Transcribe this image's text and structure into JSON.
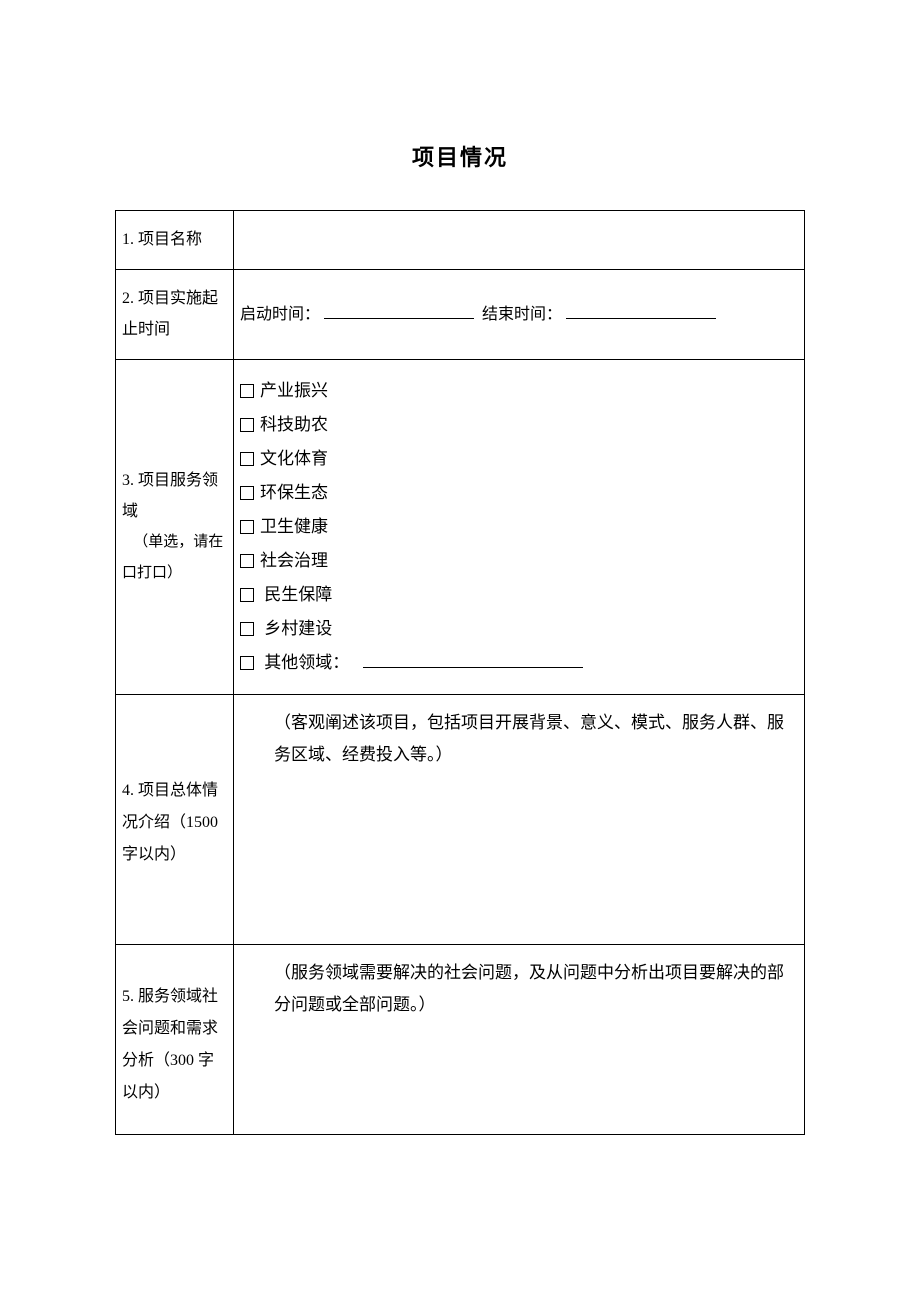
{
  "title": "项目情况",
  "rows": {
    "r1_label": "1. 项目名称",
    "r2_label": "2. 项目实施起止时间",
    "r2_start": "启动时间：",
    "r2_end": "结束时间：",
    "r3_label_main": "3. 项目服务领域",
    "r3_label_hint": "（单选，请在口打口）",
    "r3_options": {
      "o1": "产业振兴",
      "o2": "科技助农",
      "o3": "文化体育",
      "o4": "环保生态",
      "o5": "卫生健康",
      "o6": "社会治理",
      "o7": "民生保障",
      "o8": "乡村建设",
      "o9": "其他领域："
    },
    "r4_label": "4. 项目总体情况介绍（1500字以内）",
    "r4_desc": "（客观阐述该项目，包括项目开展背景、意义、模式、服务人群、服务区域、经费投入等。）",
    "r5_label": "5. 服务领域社会问题和需求分析（300 字以内）",
    "r5_desc": "（服务领域需要解决的社会问题，及从问题中分析出项目要解决的部分问题或全部问题。）"
  }
}
